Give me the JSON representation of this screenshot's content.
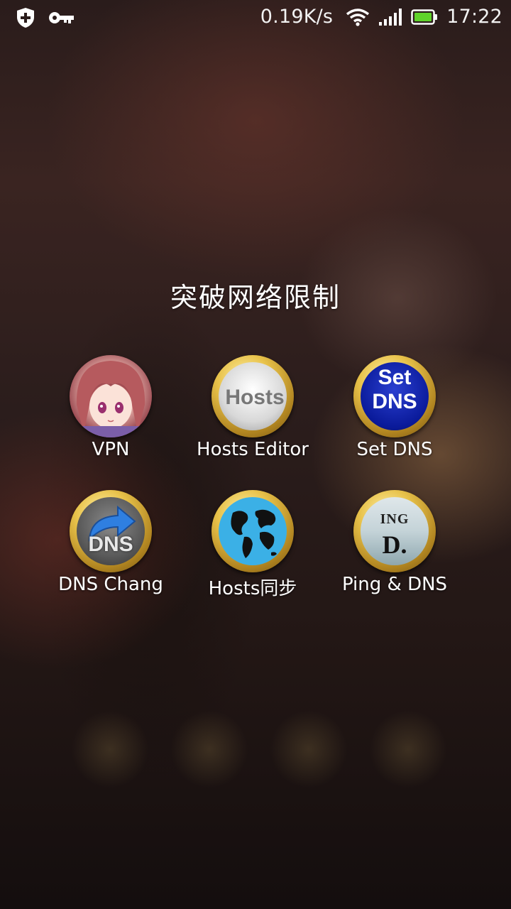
{
  "status_bar": {
    "left_icons": [
      "shield-plus-icon",
      "key-icon"
    ],
    "net_speed": "0.19K/s",
    "right_icons": [
      "wifi-icon",
      "signal-icon",
      "battery-icon"
    ],
    "time": "17:22"
  },
  "folder": {
    "title": "突破网络限制",
    "apps": [
      {
        "label": "VPN",
        "icon": "anime-avatar-icon"
      },
      {
        "label": "Hosts Editor",
        "icon": "hosts-editor-icon",
        "icon_text": "Hosts"
      },
      {
        "label": "Set DNS",
        "icon": "set-dns-icon",
        "icon_text_1": "Set",
        "icon_text_2": "DNS"
      },
      {
        "label": "DNS Chang",
        "icon": "dns-changer-icon",
        "icon_text": "DNS"
      },
      {
        "label": "Hosts同步",
        "icon": "globe-icon"
      },
      {
        "label": "Ping & DNS",
        "icon": "ping-dns-icon",
        "icon_text_1": "ING",
        "icon_text_2": "D."
      }
    ]
  },
  "colors": {
    "battery": "#5fd32a",
    "gold": "#e8c24a",
    "set_dns_blue": "#0a1a9a",
    "globe_ocean": "#3bb0e6"
  }
}
